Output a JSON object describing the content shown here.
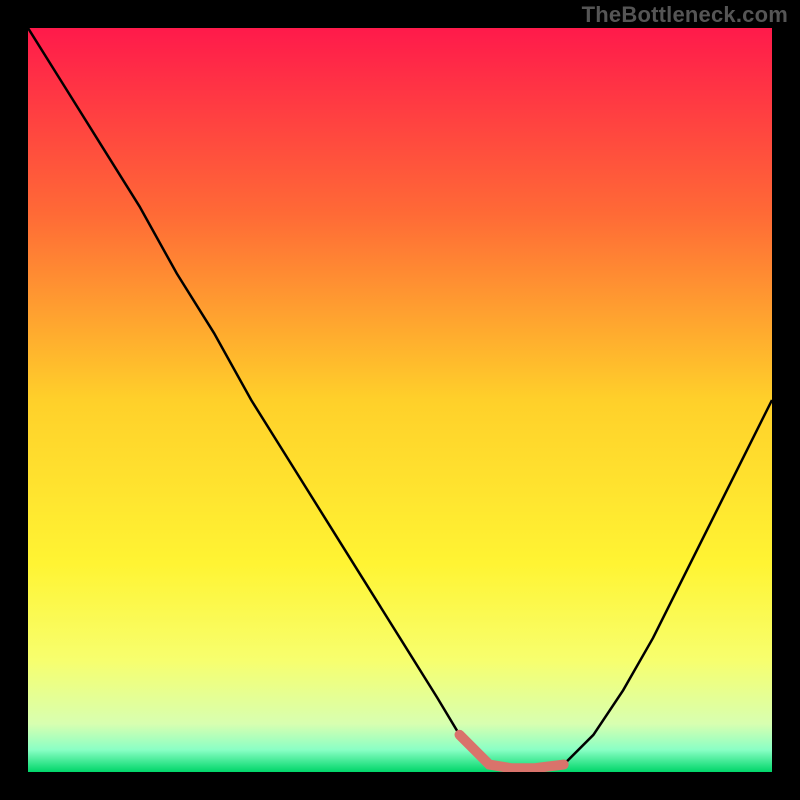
{
  "watermark": "TheBottleneck.com",
  "chart_data": {
    "type": "line",
    "title": "",
    "xlabel": "",
    "ylabel": "",
    "xlim": [
      0,
      100
    ],
    "ylim": [
      0,
      100
    ],
    "grid": false,
    "legend": false,
    "background_gradient": [
      {
        "offset": 0.0,
        "color": "#ff1a4b"
      },
      {
        "offset": 0.25,
        "color": "#ff6a36"
      },
      {
        "offset": 0.5,
        "color": "#ffd02a"
      },
      {
        "offset": 0.72,
        "color": "#fff433"
      },
      {
        "offset": 0.85,
        "color": "#f7ff6e"
      },
      {
        "offset": 0.935,
        "color": "#d8ffb0"
      },
      {
        "offset": 0.97,
        "color": "#8affc5"
      },
      {
        "offset": 1.0,
        "color": "#00d66a"
      }
    ],
    "curve": {
      "description": "Bottleneck/mismatch percentage vs. some hardware-pairing axis; V-shaped with flat minimum near x≈62–72.",
      "x": [
        0,
        5,
        10,
        15,
        20,
        25,
        30,
        35,
        40,
        45,
        50,
        55,
        58,
        62,
        65,
        68,
        72,
        76,
        80,
        84,
        88,
        92,
        96,
        100
      ],
      "y": [
        100,
        92,
        84,
        76,
        67,
        59,
        50,
        42,
        34,
        26,
        18,
        10,
        5,
        1,
        0.5,
        0.5,
        1,
        5,
        11,
        18,
        26,
        34,
        42,
        50
      ],
      "stroke": "#000000",
      "stroke_width": 2.5
    },
    "highlight_segment": {
      "description": "Emphasized flat minimum region (salmon).",
      "x": [
        58,
        62,
        65,
        68,
        72
      ],
      "y": [
        5,
        1,
        0.5,
        0.5,
        1
      ],
      "stroke": "#d9736b",
      "stroke_width": 10
    }
  }
}
